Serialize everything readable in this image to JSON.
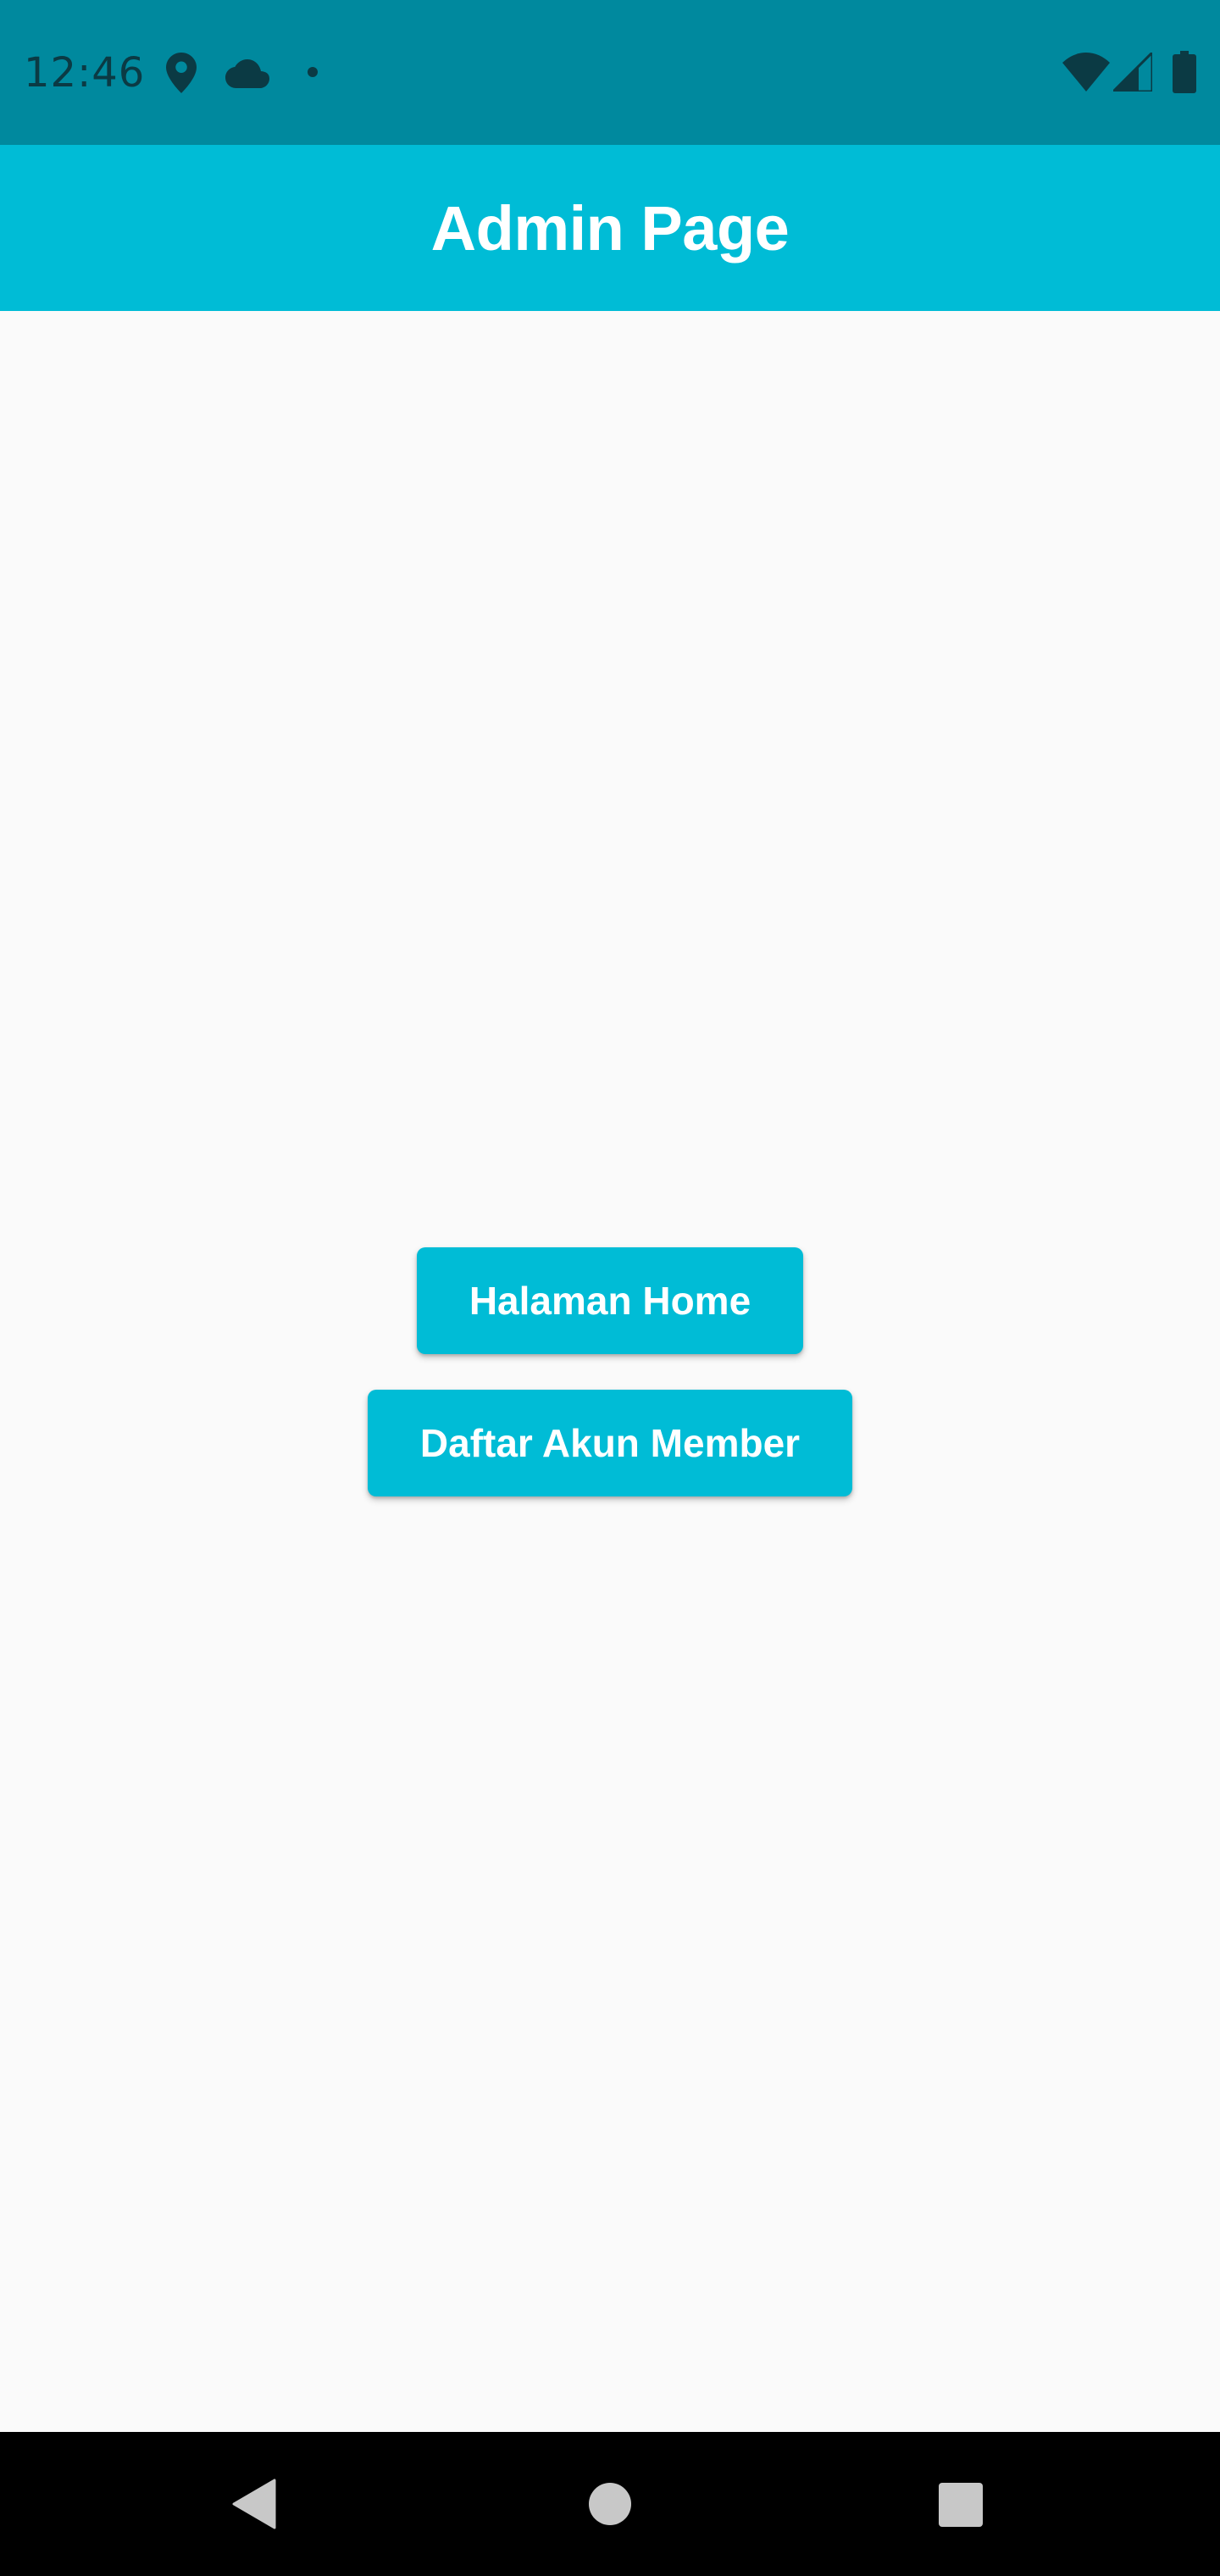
{
  "status_bar": {
    "time": "12:46",
    "icons": [
      "location-pin-icon",
      "cloud-icon",
      "notification-dot-icon",
      "wifi-icon",
      "cell-signal-icon",
      "battery-icon"
    ],
    "background_color": "#00899e"
  },
  "app_bar": {
    "title": "Admin Page",
    "background_color": "#00bcd6"
  },
  "main": {
    "buttons": [
      {
        "label": "Halaman Home"
      },
      {
        "label": "Daftar Akun Member"
      }
    ],
    "button_color": "#00bcd6",
    "background_color": "#fafafa"
  },
  "nav_bar": {
    "icons": [
      "back-icon",
      "home-icon",
      "recents-icon"
    ],
    "background_color": "#000000"
  }
}
